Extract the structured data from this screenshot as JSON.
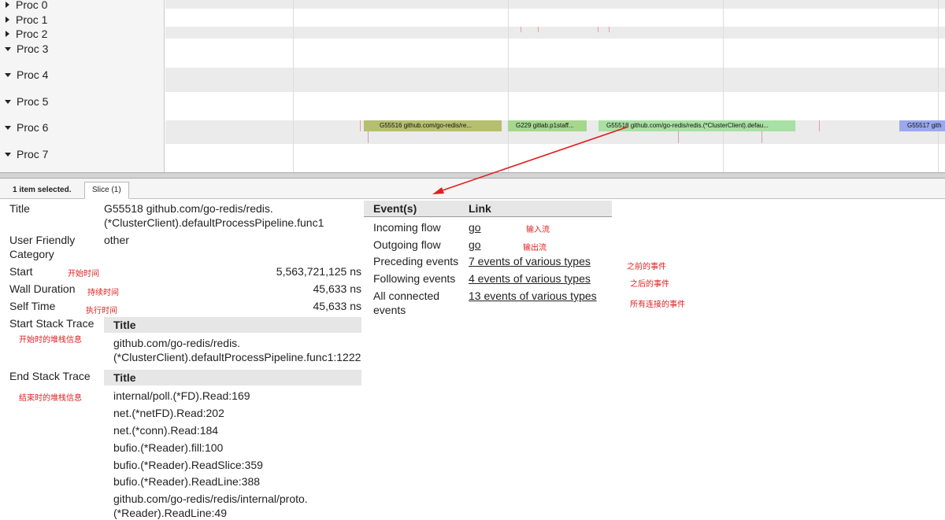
{
  "procs": [
    {
      "label": "Proc 0",
      "expanded": false
    },
    {
      "label": "Proc 1",
      "expanded": false
    },
    {
      "label": "Proc 2",
      "expanded": false
    },
    {
      "label": "Proc 3",
      "expanded": true
    },
    {
      "label": "Proc 4",
      "expanded": true
    },
    {
      "label": "Proc 5",
      "expanded": true
    },
    {
      "label": "Proc 6",
      "expanded": true
    },
    {
      "label": "Proc 7",
      "expanded": true
    }
  ],
  "slices": [
    {
      "label": "G55516 github.com/go-redis/re...",
      "color": "#b5bf6e"
    },
    {
      "label": "G229 gitlab.p1staff...",
      "color": "#a5d88c"
    },
    {
      "label": "G55518 github.com/go-redis/redis.(*ClusterClient).defau...",
      "color": "#a9e0a3"
    },
    {
      "label": "G55517 gith",
      "color": "#9ba8ee"
    }
  ],
  "tabs": {
    "selection_count": "1 item selected.",
    "active_tab": "Slice (1)"
  },
  "details": {
    "title_label": "Title",
    "title_value_line1": "G55518 github.com/go-redis/redis.",
    "title_value_line2": "(*ClusterClient).defaultProcessPipeline.func1",
    "category_label_line1": "User Friendly",
    "category_label_line2": "Category",
    "category_value": "other",
    "start_label": "Start",
    "start_value": "5,563,721,125 ns",
    "wall_label": "Wall Duration",
    "wall_value": "45,633 ns",
    "self_label": "Self Time",
    "self_value": "45,633 ns",
    "start_stack_label": "Start Stack Trace",
    "start_stack_header": "Title",
    "start_stack_line1": "github.com/go-redis/redis.",
    "start_stack_line2": "(*ClusterClient).defaultProcessPipeline.func1:1222",
    "end_stack_label": "End Stack Trace",
    "end_stack_header": "Title",
    "end_stack_frames": [
      "internal/poll.(*FD).Read:169",
      "net.(*netFD).Read:202",
      "net.(*conn).Read:184",
      "bufio.(*Reader).fill:100",
      "bufio.(*Reader).ReadSlice:359",
      "bufio.(*Reader).ReadLine:388",
      "github.com/go-redis/redis/internal/proto.",
      "(*Reader).ReadLine:49"
    ]
  },
  "events": {
    "col_event": "Event(s)",
    "col_link": "Link",
    "rows": [
      {
        "event": "Incoming flow",
        "link": "go"
      },
      {
        "event": "Outgoing flow",
        "link": "go"
      },
      {
        "event": "Preceding events",
        "link": "7 events of various types"
      },
      {
        "event": "Following events",
        "link": "4 events of various types"
      },
      {
        "event": "All connected",
        "event_line2": "events",
        "link": "13 events of various types"
      }
    ]
  },
  "annotations": {
    "start": "开始时间",
    "wall": "持续时间",
    "self": "执行时间",
    "start_stack": "开始时的堆栈信息",
    "end_stack": "结束时的堆栈信息",
    "incoming": "输入流",
    "outgoing": "输出流",
    "preceding": "之前的事件",
    "following": "之后的事件",
    "all_connected": "所有连接的事件"
  },
  "colors": {
    "annotation_red": "#e02020",
    "row_band": "#ebebeb",
    "panel_bg": "#f5f5f5"
  }
}
